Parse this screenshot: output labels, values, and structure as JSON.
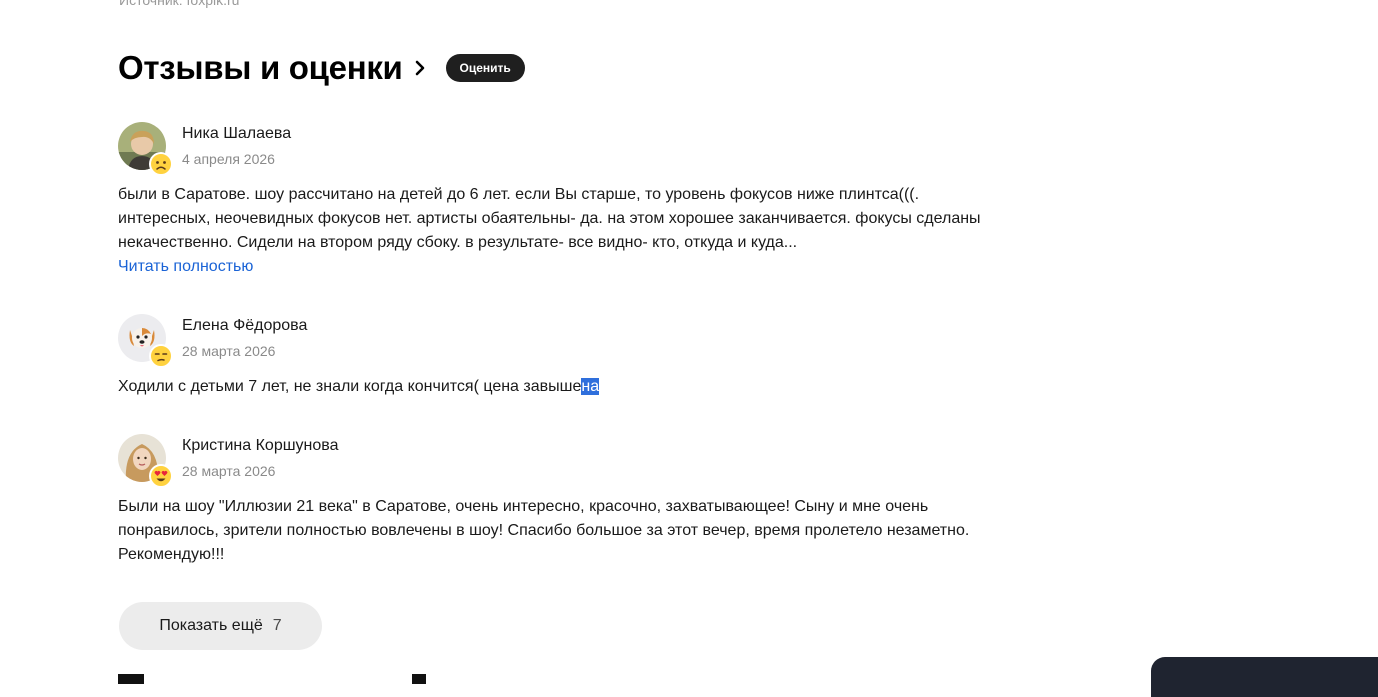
{
  "source_text": "Источник: foxpik.ru",
  "section": {
    "title": "Отзывы и оценки",
    "rate_button": "Оценить"
  },
  "reviews": [
    {
      "author": "Ника Шалаева",
      "date": "4 апреля 2026",
      "text": "были в Саратове. шоу рассчитано на детей до 6 лет. если Вы старше, то уровень фокусов ниже плинтса(((. интересных, неочевидных фокусов нет. артисты обаятельны- да. на этом хорошее заканчивается. фокусы сделаны некачественно. Сидели на втором ряду сбоку. в результате- все видно- кто, откуда и куда...",
      "read_more": "Читать полностью",
      "reaction": "sad-face-icon"
    },
    {
      "author": "Елена Фёдорова",
      "date": "28 марта 2026",
      "text_before": "Ходили с детьми 7 лет, не знали когда кончится( цена завыше",
      "text_selected": "на",
      "reaction": "unamused-face-icon"
    },
    {
      "author": "Кристина Коршунова",
      "date": "28 марта 2026",
      "text": "Были на шоу \"Иллюзии 21 века\" в Саратове, очень интересно, красочно, захватывающее! Сыну и мне очень понравилось, зрители полностью вовлечены в шоу! Спасибо большое за этот вечер, время пролетело незаметно. Рекомендую!!!",
      "reaction": "heart-eyes-face-icon"
    }
  ],
  "show_more": {
    "label": "Показать ещё",
    "count": "7"
  },
  "colors": {
    "link": "#1a63d6",
    "selection": "#2f6fdc",
    "button_dark": "#1f1f1f",
    "button_light": "#ececec"
  }
}
